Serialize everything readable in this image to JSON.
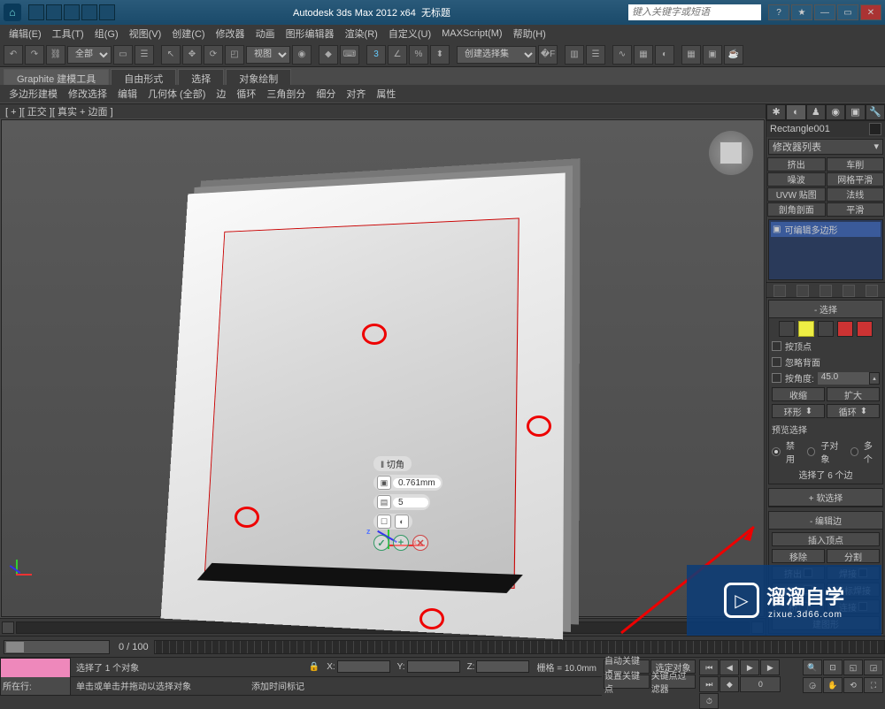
{
  "title": {
    "app": "Autodesk 3ds Max 2012",
    "arch": "x64",
    "doc": "无标题"
  },
  "searchPlaceholder": "键入关键字或短语",
  "menus": [
    "编辑(E)",
    "工具(T)",
    "组(G)",
    "视图(V)",
    "创建(C)",
    "修改器",
    "动画",
    "图形编辑器",
    "渲染(R)",
    "自定义(U)",
    "MAXScript(M)",
    "帮助(H)"
  ],
  "toolbarSelect": "全部",
  "viewDrop": "视图",
  "selSetDrop": "创建选择集",
  "ribbon": {
    "tabs": [
      "Graphite 建模工具",
      "自由形式",
      "选择",
      "对象绘制"
    ],
    "panels": [
      "多边形建模",
      "修改选择",
      "编辑",
      "几何体 (全部)",
      "边",
      "循环",
      "三角剖分",
      "细分",
      "对齐",
      "属性"
    ]
  },
  "viewportLabel": "[ + ][ 正交 ][ 真实 + 边面 ]",
  "caddy": {
    "title": "‖ 切角",
    "val1": "0.761mm",
    "val2": "5"
  },
  "axes": {
    "x": "x",
    "y": "y",
    "z": "z"
  },
  "cmdpanel": {
    "objName": "Rectangle001",
    "modList": "修改器列表",
    "modBtns": [
      "挤出",
      "车削",
      "噪波",
      "网格平滑",
      "UVW 贴图",
      "法线",
      "剖角剖面",
      "平滑"
    ],
    "stackItem": "可编辑多边形",
    "selection": {
      "title": "选择",
      "byVertex": "按顶点",
      "ignoreBack": "忽略背面",
      "byAngle": "按角度:",
      "angleVal": "45.0",
      "shrink": "收缩",
      "grow": "扩大",
      "ring": "环形",
      "loop": "循环",
      "previewLbl": "预览选择",
      "radios": [
        "禁用",
        "子对象",
        "多个"
      ],
      "selInfo": "选择了 6 个边"
    },
    "softSel": "软选择",
    "editEdge": {
      "title": "编辑边",
      "insertV": "插入顶点",
      "remove": "移除",
      "split": "分割",
      "extrude": "挤出",
      "weld": "焊接",
      "chamfer": "切角",
      "targetWeld": "目标焊接",
      "bridge": "桥",
      "connect": "连接",
      "createShape": "建图形"
    }
  },
  "timeline": {
    "range": "0 / 100"
  },
  "status": {
    "selMsg": "选择了 1 个对象",
    "hint": "单击或单击并拖动以选择对象",
    "addTime": "添加时间标记",
    "x": "X:",
    "y": "Y:",
    "z": "Z:",
    "grid": "栅格 = 10.0mm",
    "autoKey": "自动关键点",
    "selSet2": "选定对象",
    "setKey": "设置关键点",
    "keyFilter": "关键点过滤器",
    "nowAt": "所在行:"
  },
  "watermark": {
    "big": "溜溜自学",
    "small": "zixue.3d66.com"
  }
}
